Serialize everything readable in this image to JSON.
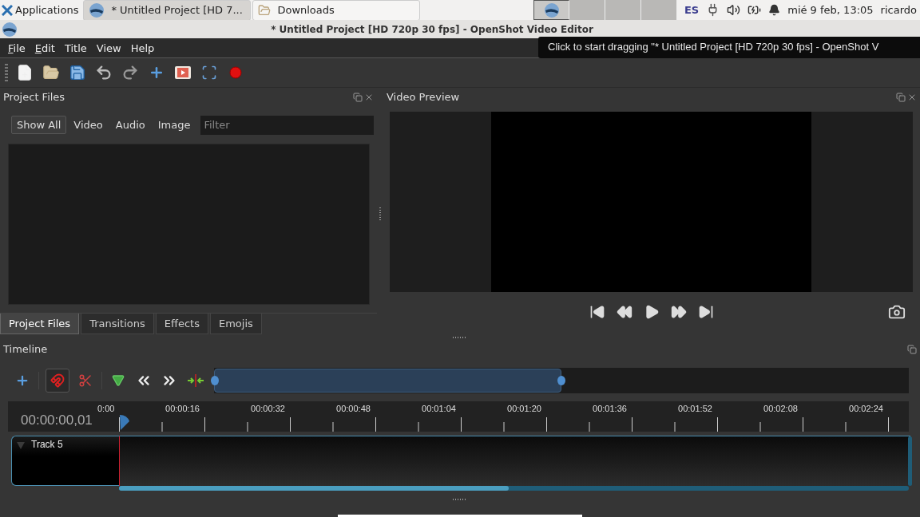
{
  "taskbar": {
    "apps_menu": "Applications",
    "tasks": [
      {
        "label": "* Untitled Project [HD 7...",
        "selected": true
      },
      {
        "label": "Downloads",
        "selected": false
      }
    ],
    "workspaces": [
      {
        "selected": true
      },
      {
        "selected": false
      },
      {
        "selected": false
      },
      {
        "selected": false
      }
    ],
    "keyboard_layout": "ES",
    "clock": "mié  9 feb, 13:05",
    "user": "ricardo"
  },
  "window": {
    "title": "* Untitled Project [HD 720p 30 fps] - OpenShot Video Editor"
  },
  "tooltip": "Click to start dragging \"* Untitled Project [HD 720p 30 fps] - OpenShot V",
  "menu": [
    {
      "label": "File",
      "underline_first": true
    },
    {
      "label": "Edit",
      "underline_first": true
    },
    {
      "label": "Title",
      "underline_first": false
    },
    {
      "label": "View",
      "underline_first": false
    },
    {
      "label": "Help",
      "underline_first": false
    }
  ],
  "project_files": {
    "title": "Project Files",
    "filters": [
      {
        "label": "Show All",
        "selected": true
      },
      {
        "label": "Video",
        "selected": false
      },
      {
        "label": "Audio",
        "selected": false
      },
      {
        "label": "Image",
        "selected": false
      }
    ],
    "filter_placeholder": "Filter",
    "tabs": [
      {
        "label": "Project Files",
        "selected": true
      },
      {
        "label": "Transitions",
        "selected": false
      },
      {
        "label": "Effects",
        "selected": false
      },
      {
        "label": "Emojis",
        "selected": false
      }
    ]
  },
  "video_preview": {
    "title": "Video Preview"
  },
  "timeline": {
    "title": "Timeline",
    "snapping": true,
    "zoom": {
      "level": 0.5
    },
    "timecode": "00:00:00,01",
    "ruler": [
      "0:00",
      "00:00:16",
      "00:00:32",
      "00:00:48",
      "00:01:04",
      "00:01:20",
      "00:01:36",
      "00:01:52",
      "00:02:08",
      "00:02:24"
    ],
    "tracks": [
      {
        "name": "Track 5"
      }
    ]
  }
}
